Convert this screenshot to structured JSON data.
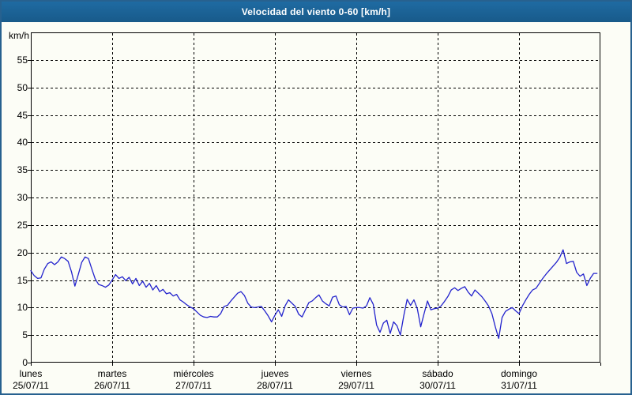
{
  "window": {
    "title": "Velocidad del viento 0-60 [km/h]"
  },
  "y_axis": {
    "unit": "km/h",
    "ticks": [
      0,
      5,
      10,
      15,
      20,
      25,
      30,
      35,
      40,
      45,
      50,
      55
    ],
    "min": 0,
    "max": 60
  },
  "x_axis": {
    "days": [
      {
        "name": "lunes",
        "date": "25/07/11"
      },
      {
        "name": "martes",
        "date": "26/07/11"
      },
      {
        "name": "miércoles",
        "date": "27/07/11"
      },
      {
        "name": "jueves",
        "date": "28/07/11"
      },
      {
        "name": "viernes",
        "date": "29/07/11"
      },
      {
        "name": "sábado",
        "date": "30/07/11"
      },
      {
        "name": "domingo",
        "date": "31/07/11"
      }
    ]
  },
  "colors": {
    "title_bar": "#1c6093",
    "window_border": "#27618f",
    "background": "#fcfdf6",
    "line": "#2323cd",
    "grid": "#000000"
  },
  "chart_data": {
    "type": "line",
    "title": "Velocidad del viento 0-60 [km/h]",
    "ylabel": "km/h",
    "ylim": [
      0,
      60
    ],
    "grid": true,
    "x_days": 7,
    "sampling": "hourly, starting lunes 25/07/11 00:00",
    "x_tick_labels": [
      "lunes 25/07/11",
      "martes 26/07/11",
      "miércoles 27/07/11",
      "jueves 28/07/11",
      "viernes 29/07/11",
      "sábado 30/07/11",
      "domingo 31/07/11"
    ],
    "series": [
      {
        "name": "Velocidad del viento [km/h]",
        "values": [
          16.7,
          15.8,
          15.3,
          15.4,
          17.0,
          18.0,
          18.3,
          17.8,
          18.3,
          19.2,
          18.9,
          18.4,
          16.5,
          13.9,
          16.0,
          18.2,
          19.2,
          18.9,
          17.0,
          15.2,
          14.2,
          14.0,
          13.7,
          14.1,
          15.0,
          16.0,
          15.3,
          15.6,
          14.9,
          15.5,
          14.3,
          15.3,
          14.0,
          14.8,
          13.7,
          14.4,
          13.2,
          14.0,
          12.9,
          13.3,
          12.5,
          12.7,
          12.1,
          12.4,
          11.4,
          11.0,
          10.5,
          10.1,
          9.8,
          9.2,
          8.6,
          8.3,
          8.2,
          8.4,
          8.3,
          8.3,
          8.9,
          10.2,
          10.4,
          11.2,
          11.9,
          12.6,
          12.9,
          12.2,
          10.8,
          10.1,
          10.0,
          10.1,
          10.2,
          9.4,
          8.5,
          7.4,
          8.6,
          9.6,
          8.4,
          10.3,
          11.4,
          10.8,
          10.2,
          8.8,
          8.3,
          9.6,
          10.9,
          11.2,
          11.8,
          12.3,
          11.2,
          10.7,
          10.3,
          11.9,
          12.1,
          10.5,
          10.1,
          10.2,
          8.7,
          9.9,
          10.0,
          10.0,
          9.9,
          10.3,
          11.8,
          10.6,
          6.8,
          5.5,
          7.2,
          7.7,
          5.3,
          7.4,
          6.7,
          5.0,
          8.5,
          11.5,
          10.4,
          11.4,
          9.8,
          6.5,
          8.9,
          11.2,
          9.6,
          9.8,
          9.9,
          10.3,
          11.1,
          12.0,
          13.2,
          13.6,
          13.1,
          13.5,
          13.8,
          12.8,
          12.1,
          13.2,
          12.6,
          12.0,
          11.2,
          10.3,
          8.9,
          6.5,
          4.4,
          8.2,
          9.3,
          9.7,
          10.0,
          9.4,
          8.9,
          10.3,
          11.4,
          12.4,
          13.2,
          13.5,
          14.4,
          15.3,
          16.1,
          16.8,
          17.5,
          18.2,
          19.1,
          20.5,
          18.0,
          18.3,
          18.4,
          16.4,
          15.7,
          16.1,
          14.0,
          15.3,
          16.2,
          16.2
        ]
      }
    ]
  }
}
